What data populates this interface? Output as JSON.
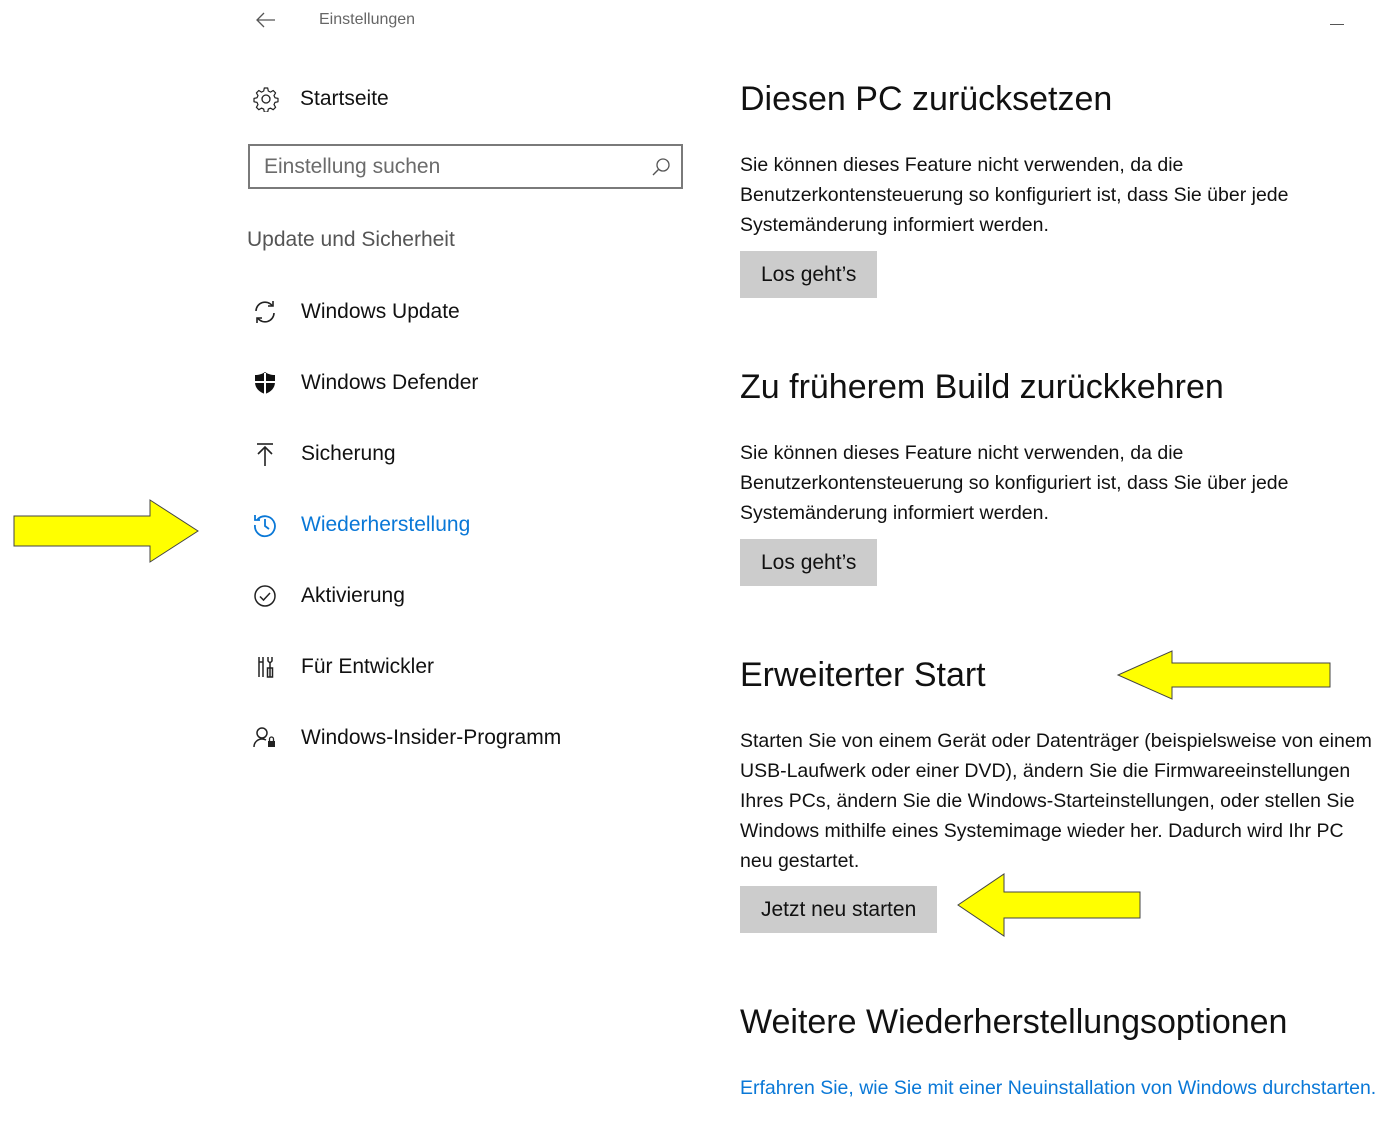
{
  "titlebar": {
    "title": "Einstellungen"
  },
  "sidebar": {
    "home_label": "Startseite",
    "search_placeholder": "Einstellung suchen",
    "section_heading": "Update und Sicherheit",
    "items": [
      {
        "label": "Windows Update",
        "icon": "sync-icon",
        "active": false
      },
      {
        "label": "Windows Defender",
        "icon": "shield-icon",
        "active": false
      },
      {
        "label": "Sicherung",
        "icon": "upload-icon",
        "active": false
      },
      {
        "label": "Wiederherstellung",
        "icon": "history-icon",
        "active": true
      },
      {
        "label": "Aktivierung",
        "icon": "check-circle-icon",
        "active": false
      },
      {
        "label": "Für Entwickler",
        "icon": "developer-tools-icon",
        "active": false
      },
      {
        "label": "Windows-Insider-Programm",
        "icon": "insider-icon",
        "active": false
      }
    ]
  },
  "main": {
    "reset": {
      "heading": "Diesen PC zurücksetzen",
      "text": "Sie können dieses Feature nicht verwenden, da die Benutzerkontensteuerung so konfiguriert ist, dass Sie über jede Systemänderung informiert werden.",
      "button": "Los geht’s"
    },
    "rollback": {
      "heading": "Zu früherem Build zurückkehren",
      "text": "Sie können dieses Feature nicht verwenden, da die Benutzerkontensteuerung so konfiguriert ist, dass Sie über jede Systemänderung informiert werden.",
      "button": "Los geht’s"
    },
    "advanced": {
      "heading": "Erweiterter Start",
      "text": "Starten Sie von einem Gerät oder Datenträger (beispielsweise von einem USB-Laufwerk oder einer DVD), ändern Sie die Firmwareeinstellungen Ihres PCs, ändern Sie die Windows-Starteinstellungen, oder stellen Sie Windows mithilfe eines Systemimage wieder her. Dadurch wird Ihr PC neu gestartet.",
      "button": "Jetzt neu starten"
    },
    "more": {
      "heading": "Weitere Wiederherstellungsoptionen",
      "link": "Erfahren Sie, wie Sie mit einer Neuinstallation von Windows durchstarten."
    }
  },
  "colors": {
    "accent": "#0a78d7",
    "button_bg": "#cccccc",
    "annotation_arrow": "#ffff00"
  }
}
